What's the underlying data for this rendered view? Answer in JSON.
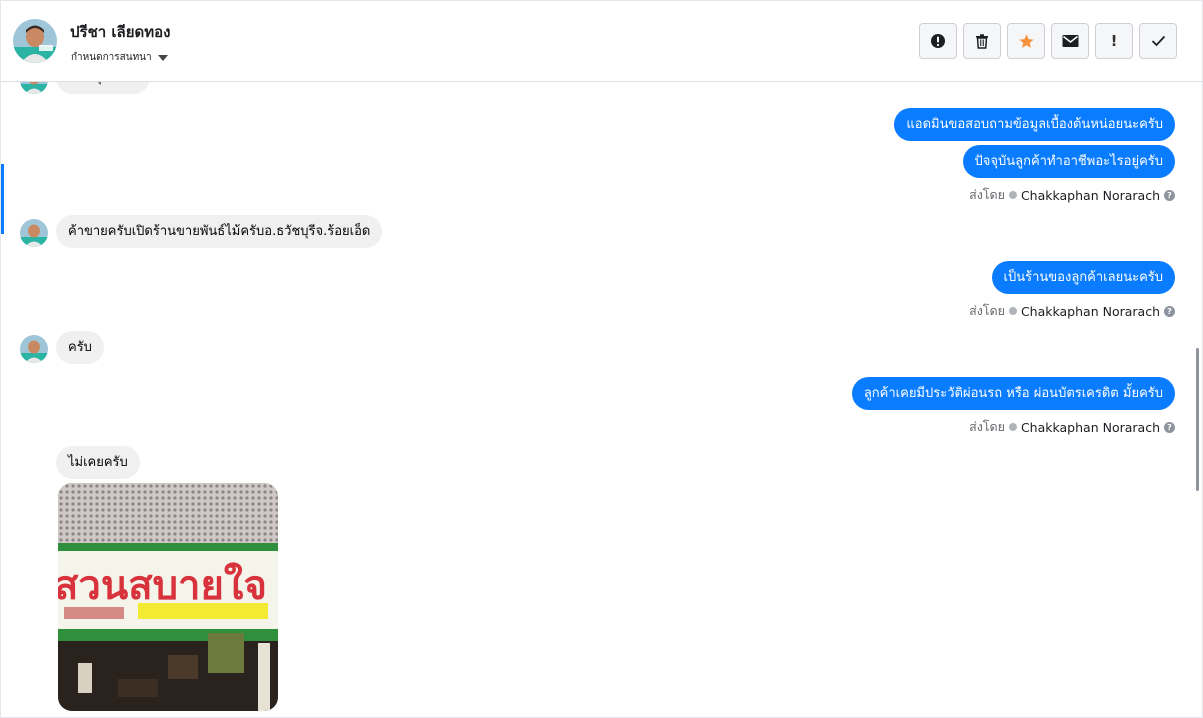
{
  "header": {
    "name": "ปรีชา เลียดทอง",
    "subtitle": "กำหนดการสนทนา"
  },
  "toolbar": {
    "buttons": [
      {
        "name": "alert-circle-icon"
      },
      {
        "name": "trash-icon"
      },
      {
        "name": "star-icon",
        "color": "#f7923b"
      },
      {
        "name": "envelope-icon"
      },
      {
        "name": "exclamation-icon",
        "label": "!"
      },
      {
        "name": "check-icon"
      }
    ]
  },
  "messages": {
    "partial_top": "ขอบคุณครับ",
    "out1": "แอดมินขอสอบถามข้อมูลเบื้องต้นหน่อยนะครับ",
    "out2": "ปัจจุบันลูกค้าทำอาชีพอะไรอยู่ครับ",
    "in1": "ค้าขายครับเปิดร้านขายพันธ์ไม้ครับอ.ธวัชบุรีจ.ร้อยเอ็ด",
    "out3": "เป็นร้านของลูกค้าเลยนะครับ",
    "in2": "ครับ",
    "out4": "ลูกค้าเคยมีประวัติผ่อนรถ หรือ ผ่อนบัตรเครดิต มั้ยครับ",
    "in3": "ไม่เคยครับ"
  },
  "sent_by": {
    "prefix": "ส่งโดย",
    "agent": "Chakkaphan Norarach",
    "help": "?"
  },
  "photo": {
    "sign_text": "สวนสบายใจ"
  },
  "colors": {
    "accent": "#0a7cff",
    "incoming_bubble": "#f0f0f0"
  }
}
